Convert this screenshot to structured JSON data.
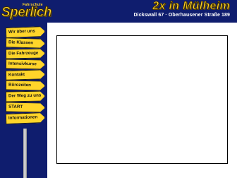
{
  "header": {
    "logo_small": "Fahrschule",
    "logo_main": "Sperlich",
    "headline": "2x in Mülheim",
    "address": "Dickswall 67 · Oberhausener Straße 189"
  },
  "nav": {
    "items": [
      {
        "label": "Wir über uns"
      },
      {
        "label": "Die Klassen"
      },
      {
        "label": "Die Fahrzeuge"
      },
      {
        "label": "Intensivkurse"
      },
      {
        "label": "Kontakt"
      },
      {
        "label": "Bürozeiten"
      },
      {
        "label": "Der Weg zu uns"
      },
      {
        "label": "START"
      },
      {
        "label": "Informationen"
      }
    ]
  },
  "colors": {
    "brand_blue": "#0f1d6e",
    "sign_yellow": "#ffd52a"
  }
}
